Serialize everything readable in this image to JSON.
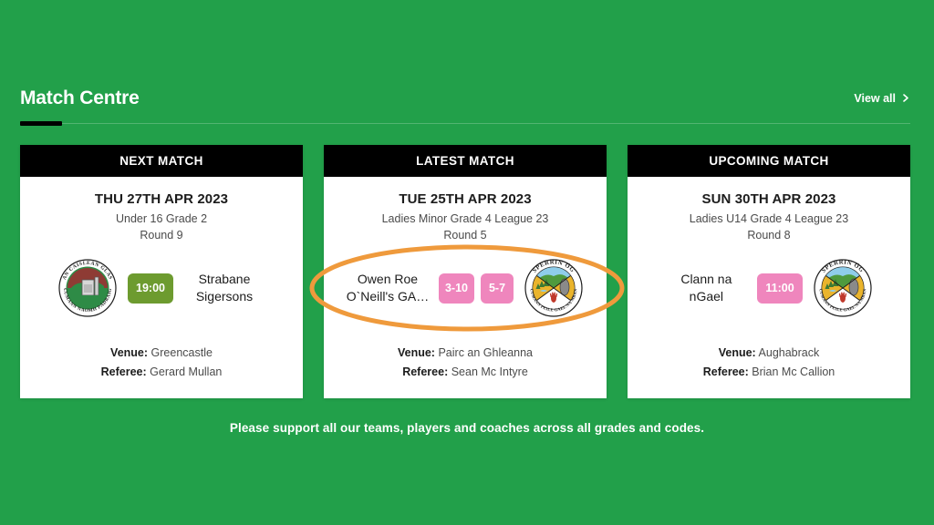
{
  "theme": {
    "background": "#22a04a",
    "card_background": "#ffffff",
    "card_header_background": "#000000",
    "accent_underline": "#000000",
    "time_badge_green": "#6d9b2f",
    "time_badge_pink": "#ef86bd",
    "score_badge_pink": "#ef86bd",
    "annotation_orange": "#ef9a3c"
  },
  "header": {
    "title": "Match Centre",
    "view_all_label": "View all",
    "view_all_icon": "chevron-right-icon"
  },
  "cards": [
    {
      "header": "NEXT MATCH",
      "date": "THU 27TH APR 2023",
      "competition": "Under 16 Grade 2",
      "round": "Round 9",
      "home": {
        "name": "",
        "crest": "greencastle-crest"
      },
      "away": {
        "name": "Strabane Sigersons",
        "crest": ""
      },
      "center_badge": {
        "type": "time",
        "text": "19:00",
        "color": "#6d9b2f"
      },
      "venue_label": "Venue:",
      "venue": "Greencastle",
      "referee_label": "Referee:",
      "referee": "Gerard Mullan"
    },
    {
      "header": "LATEST MATCH",
      "date": "TUE 25TH APR 2023",
      "competition": "Ladies Minor Grade 4 League 23",
      "round": "Round 5",
      "home": {
        "name": "Owen Roe O`Neill's GA…",
        "crest": ""
      },
      "away": {
        "name": "",
        "crest": "sperrin-og-crest"
      },
      "scores": [
        "3-10",
        "5-7"
      ],
      "venue_label": "Venue:",
      "venue": "Pairc an Ghleanna",
      "referee_label": "Referee:",
      "referee": "Sean Mc Intyre"
    },
    {
      "header": "UPCOMING MATCH",
      "date": "SUN 30TH APR 2023",
      "competition": "Ladies U14 Grade 4 League 23",
      "round": "Round 8",
      "home": {
        "name": "Clann na nGael",
        "crest": ""
      },
      "away": {
        "name": "",
        "crest": "sperrin-og-crest"
      },
      "center_badge": {
        "type": "time",
        "text": "11:00",
        "color": "#ef86bd"
      },
      "venue_label": "Venue:",
      "venue": "Aughabrack",
      "referee_label": "Referee:",
      "referee": "Brian Mc Callion"
    }
  ],
  "annotation": {
    "shape": "ellipse-highlight",
    "color": "#ef9a3c",
    "target": "latest-match-fixture-row"
  },
  "footer": {
    "message": "Please support all our teams, players and coaches across all grades and codes."
  }
}
